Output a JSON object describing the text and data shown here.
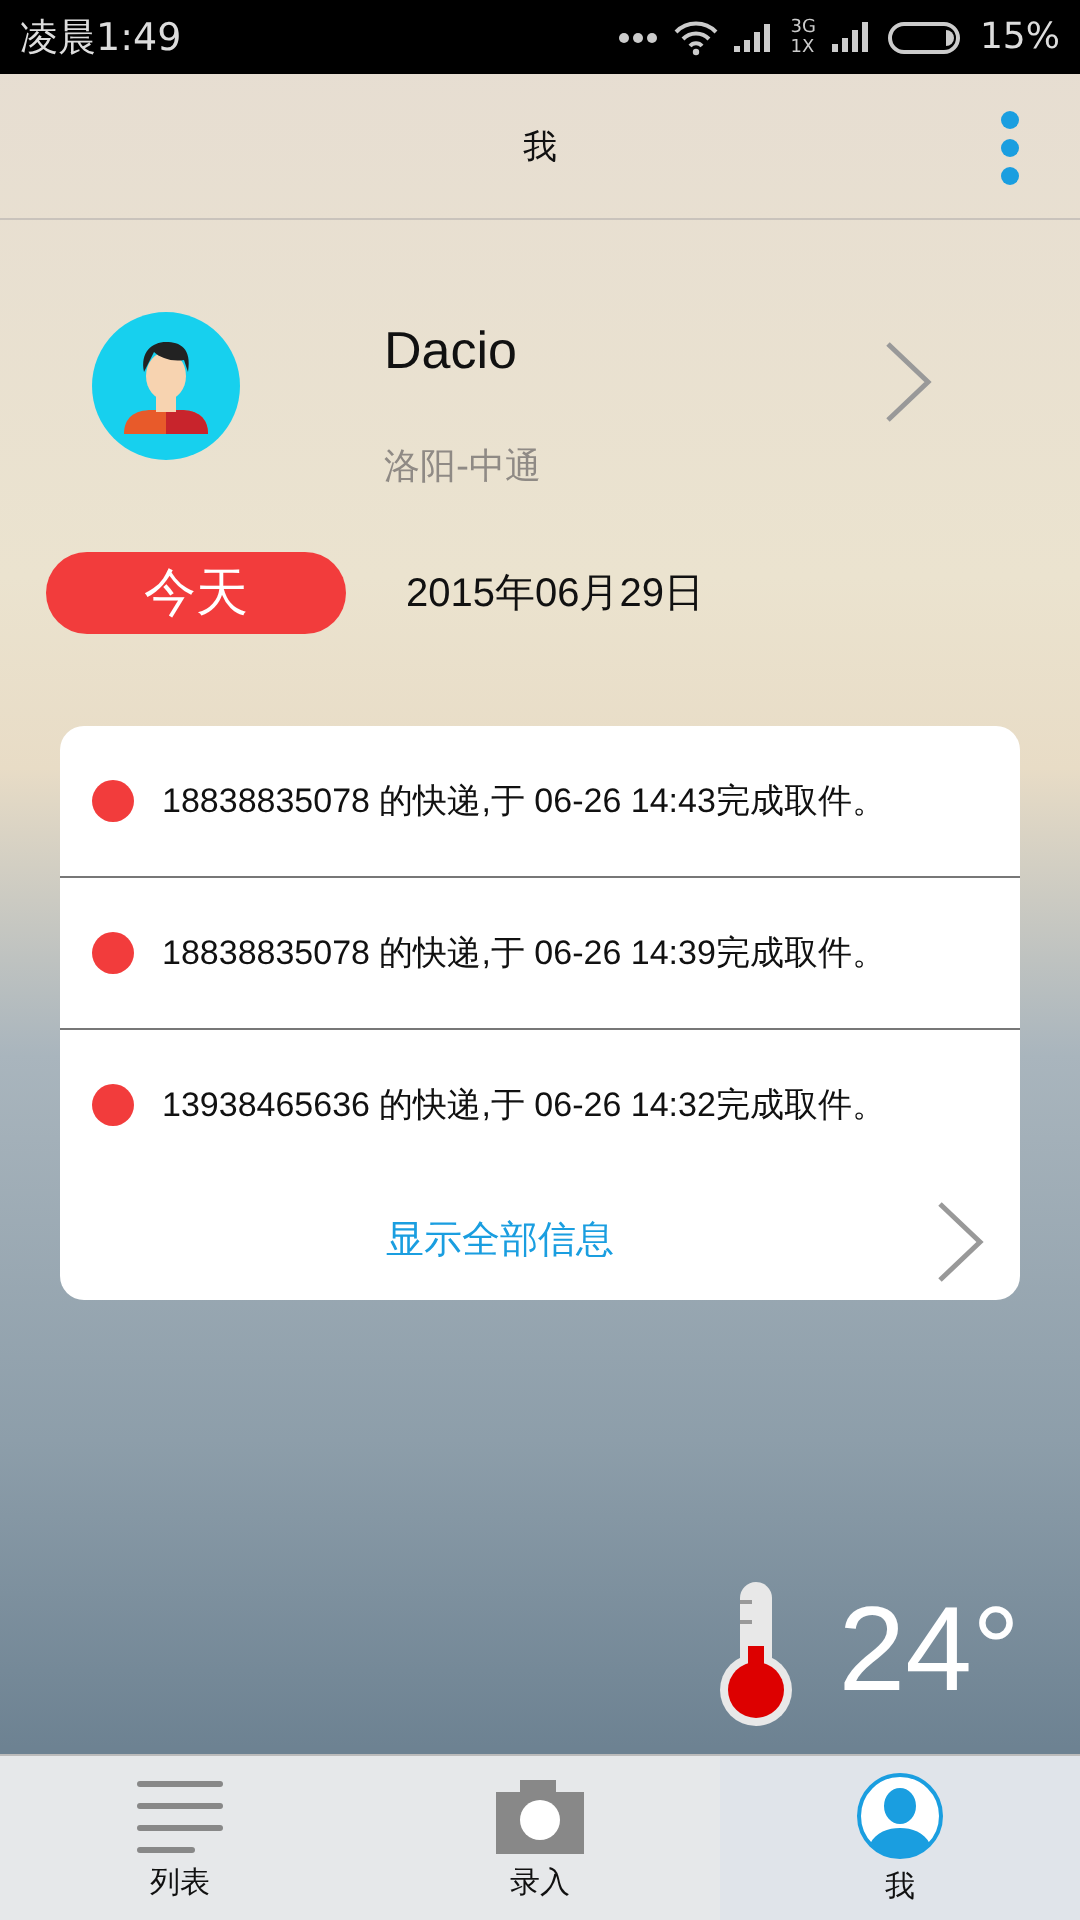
{
  "status_bar": {
    "time": "凌晨1:49",
    "network_top": "3G",
    "network_bottom": "1X",
    "battery": "15%"
  },
  "header": {
    "title": "我"
  },
  "profile": {
    "name": "Dacio",
    "subtitle": "洛阳-中通"
  },
  "today": {
    "badge": "今天",
    "date": "2015年06月29日"
  },
  "messages": [
    {
      "text": "18838835078 的快递,于 06-26 14:43完成取件。"
    },
    {
      "text": "18838835078 的快递,于 06-26 14:39完成取件。"
    },
    {
      "text": "13938465636 的快递,于 06-26 14:32完成取件。"
    }
  ],
  "show_all": "显示全部信息",
  "weather": {
    "temperature": "24°"
  },
  "tabs": [
    {
      "label": "列表",
      "kind": "list",
      "selected": false
    },
    {
      "label": "录入",
      "kind": "camera",
      "selected": false
    },
    {
      "label": "我",
      "kind": "user",
      "selected": true
    }
  ]
}
